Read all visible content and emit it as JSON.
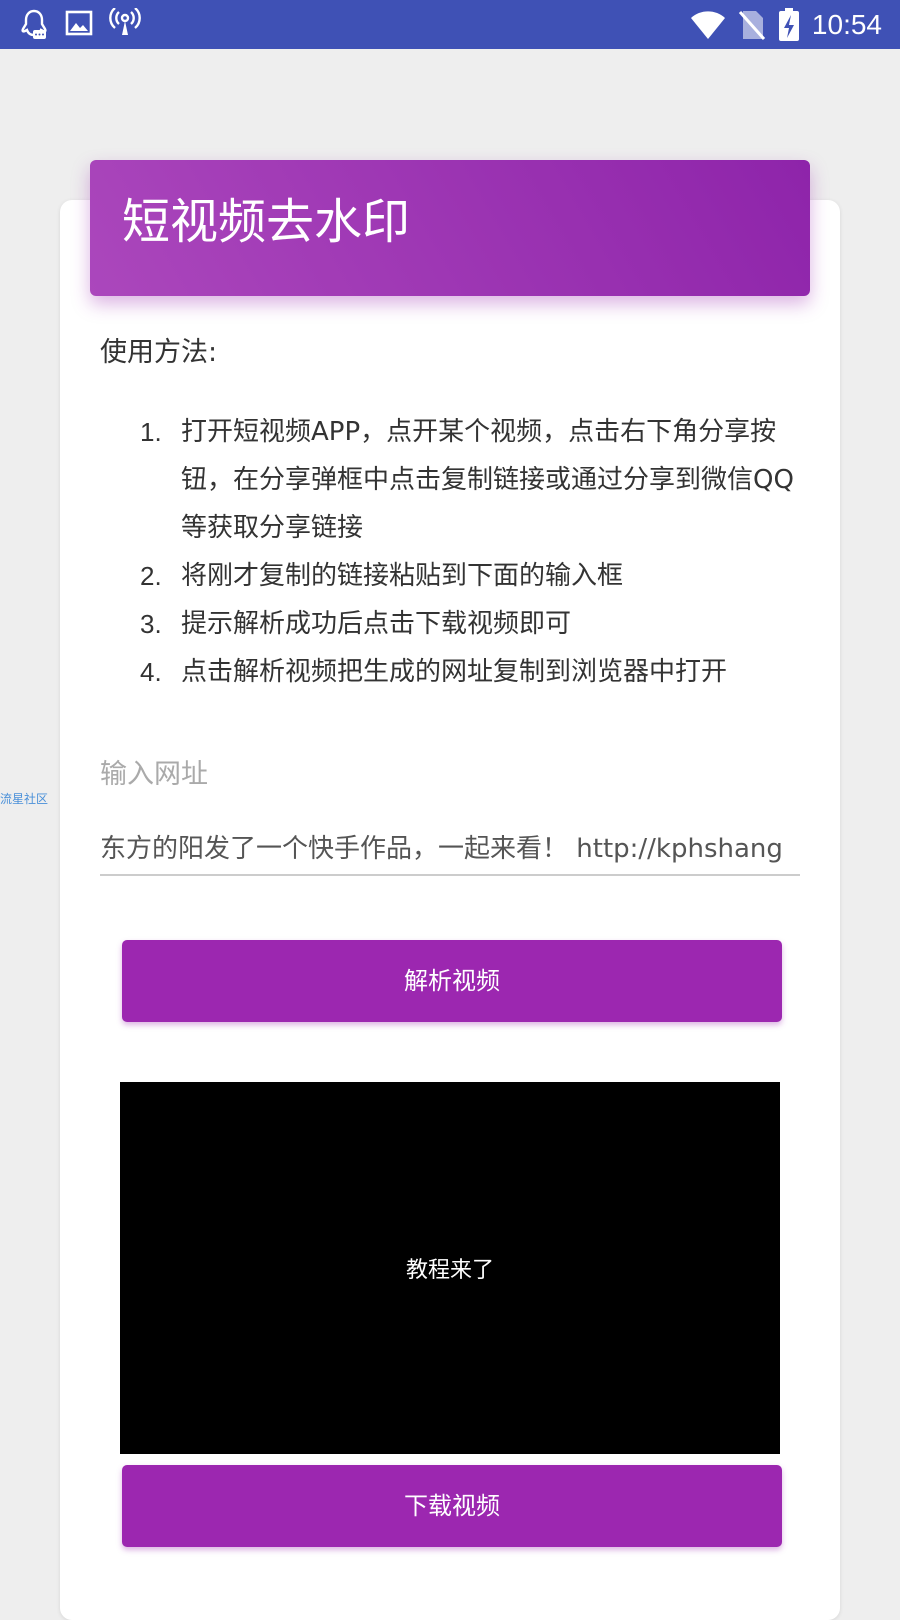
{
  "status_bar": {
    "time": "10:54",
    "left_icons": [
      "qq-icon",
      "image-icon",
      "hotspot-icon"
    ],
    "right_icons": [
      "wifi-icon",
      "no-sim-icon",
      "battery-charging-icon"
    ]
  },
  "side_watermark": "流星社区",
  "card": {
    "title": "短视频去水印",
    "usage_label": "使用方法:",
    "steps": [
      {
        "num": "1.",
        "text": "打开短视频APP，点开某个视频，点击右下角分享按钮，在分享弹框中点击复制链接或通过分享到微信QQ等获取分享链接"
      },
      {
        "num": "2.",
        "text": "将刚才复制的链接粘贴到下面的输入框"
      },
      {
        "num": "3.",
        "text": "提示解析成功后点击下载视频即可"
      },
      {
        "num": "4.",
        "text": "点击解析视频把生成的网址复制到浏览器中打开"
      }
    ],
    "input": {
      "label": "输入网址",
      "value": "东方的阳发了一个快手作品，一起来看！ http://kphshang"
    },
    "parse_button": "解析视频",
    "video_caption": "教程来了",
    "download_button": "下载视频"
  },
  "colors": {
    "status_bar": "#3f51b5",
    "accent": "#9c27b0",
    "header_gradient_start": "#ab47bc",
    "header_gradient_end": "#8e24aa"
  }
}
